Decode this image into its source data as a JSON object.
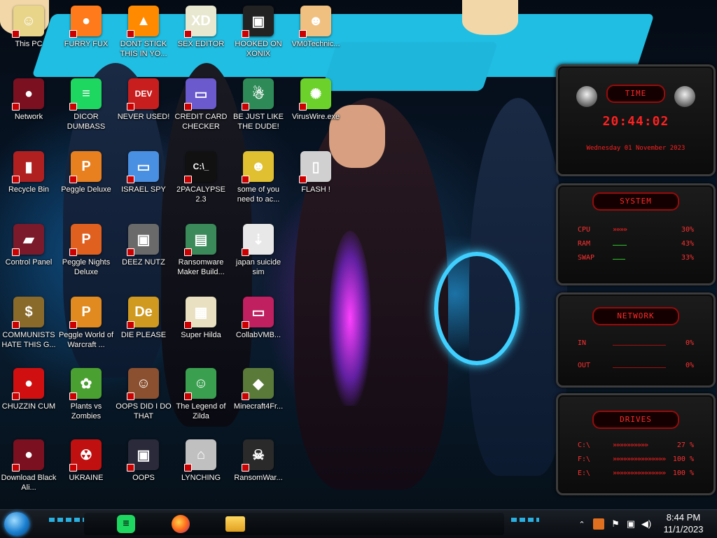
{
  "desktop": {
    "icons": [
      {
        "label": "This PC",
        "color": "#e8d58a",
        "glyph": "☺"
      },
      {
        "label": "FURRY FUX",
        "color": "#ff7a1a",
        "glyph": "●"
      },
      {
        "label": "DONT STICK THIS IN YO...",
        "color": "#ff8a00",
        "glyph": "▲"
      },
      {
        "label": "SEX EDITOR",
        "color": "#e8e8d0",
        "glyph": "XD"
      },
      {
        "label": "HOOKED ON XONIX",
        "color": "#222222",
        "glyph": "▣"
      },
      {
        "label": "VM0Technic...",
        "color": "#f0c080",
        "glyph": "☻"
      },
      {
        "label": "Network",
        "color": "#7a1020",
        "glyph": "●"
      },
      {
        "label": "DICOR DUMBASS",
        "color": "#1ed760",
        "glyph": "≡"
      },
      {
        "label": "NEVER USED!",
        "color": "#c81e1e",
        "glyph": "DEV"
      },
      {
        "label": "CREDIT CARD CHECKER",
        "color": "#6a5acd",
        "glyph": "▭"
      },
      {
        "label": "BE JUST LIKE THE DUDE!",
        "color": "#2e8b57",
        "glyph": "☃"
      },
      {
        "label": "VirusWire.exe",
        "color": "#6cd12a",
        "glyph": "✺"
      },
      {
        "label": "Recycle Bin",
        "color": "#b02020",
        "glyph": "▮"
      },
      {
        "label": "Peggle Deluxe",
        "color": "#e88020",
        "glyph": "P"
      },
      {
        "label": "ISRAEL SPY",
        "color": "#4a90e2",
        "glyph": "▭"
      },
      {
        "label": "2PACALYPSE 2.3",
        "color": "#111111",
        "glyph": "C:\\_"
      },
      {
        "label": "some of you need to ac...",
        "color": "#e0c030",
        "glyph": "☻"
      },
      {
        "label": "FLASH !",
        "color": "#d0d0d0",
        "glyph": "▯"
      },
      {
        "label": "Control Panel",
        "color": "#7a1a2a",
        "glyph": "▰"
      },
      {
        "label": "Peggle Nights Deluxe",
        "color": "#e06020",
        "glyph": "P"
      },
      {
        "label": "DEEZ NUTZ",
        "color": "#6a6a6a",
        "glyph": "▣"
      },
      {
        "label": "Ransomware Maker Build...",
        "color": "#3a8a5a",
        "glyph": "▤"
      },
      {
        "label": "japan suicide sim",
        "color": "#e8e8e8",
        "glyph": "⇣"
      },
      {
        "label": "COMMUNISTS HATE THIS G...",
        "color": "#8a6a2a",
        "glyph": "$"
      },
      {
        "label": "Peggle World of Warcraft ...",
        "color": "#e08a20",
        "glyph": "P"
      },
      {
        "label": "DIE PLEASE",
        "color": "#d09a20",
        "glyph": "De"
      },
      {
        "label": "Super Hilda",
        "color": "#e8e0c0",
        "glyph": "▦"
      },
      {
        "label": "CollabVMB...",
        "color": "#c02060",
        "glyph": "▭"
      },
      {
        "label": "CHUZZIN CUM",
        "color": "#d01010",
        "glyph": "●"
      },
      {
        "label": "Plants vs Zombies",
        "color": "#4aa030",
        "glyph": "✿"
      },
      {
        "label": "OOPS DID I DO THAT",
        "color": "#8a5030",
        "glyph": "☺"
      },
      {
        "label": "The Legend of Zilda",
        "color": "#3aa050",
        "glyph": "☺"
      },
      {
        "label": "Minecraft4Fr...",
        "color": "#5a7a3a",
        "glyph": "◆"
      },
      {
        "label": "Download Black Ali...",
        "color": "#7a1020",
        "glyph": "●"
      },
      {
        "label": "UKRAINE",
        "color": "#c01010",
        "glyph": "☢"
      },
      {
        "label": "OOPS",
        "color": "#2a2a3a",
        "glyph": "▣"
      },
      {
        "label": "LYNCHING",
        "color": "#c0c0c0",
        "glyph": "⌂"
      },
      {
        "label": "RansomWar...",
        "color": "#2a2a2a",
        "glyph": "☠"
      }
    ]
  },
  "widgets": {
    "time": {
      "title": "TIME",
      "clock": "20:44:02",
      "date": "Wednesday 01 November 2023"
    },
    "system": {
      "title": "SYSTEM",
      "rows": [
        {
          "name": "CPU",
          "bar": "»»»»",
          "value": "30%"
        },
        {
          "name": "RAM",
          "bar": "",
          "value": "43%"
        },
        {
          "name": "SWAP",
          "bar": "",
          "value": "33%"
        }
      ]
    },
    "network": {
      "title": "NETWORK",
      "rows": [
        {
          "name": "IN",
          "value": "0%"
        },
        {
          "name": "OUT",
          "value": "0%"
        }
      ]
    },
    "drives": {
      "title": "DRIVES",
      "rows": [
        {
          "name": "C:\\",
          "bar": "»»»»»»»»»»",
          "value": "27 %"
        },
        {
          "name": "F:\\",
          "bar": "»»»»»»»»»»»»»»»»»»»»»»»",
          "value": "100 %"
        },
        {
          "name": "E:\\",
          "bar": "»»»»»»»»»»»»»»»»»»»»»»»",
          "value": "100 %"
        }
      ]
    }
  },
  "taskbar": {
    "apps": [
      {
        "name": "spotify",
        "color": "#1ed760"
      },
      {
        "name": "firefox",
        "color": "#ff7a1a"
      },
      {
        "name": "file-explorer",
        "color": "#f0c040"
      }
    ],
    "clock": {
      "time": "8:44 PM",
      "date": "11/1/2023"
    }
  }
}
